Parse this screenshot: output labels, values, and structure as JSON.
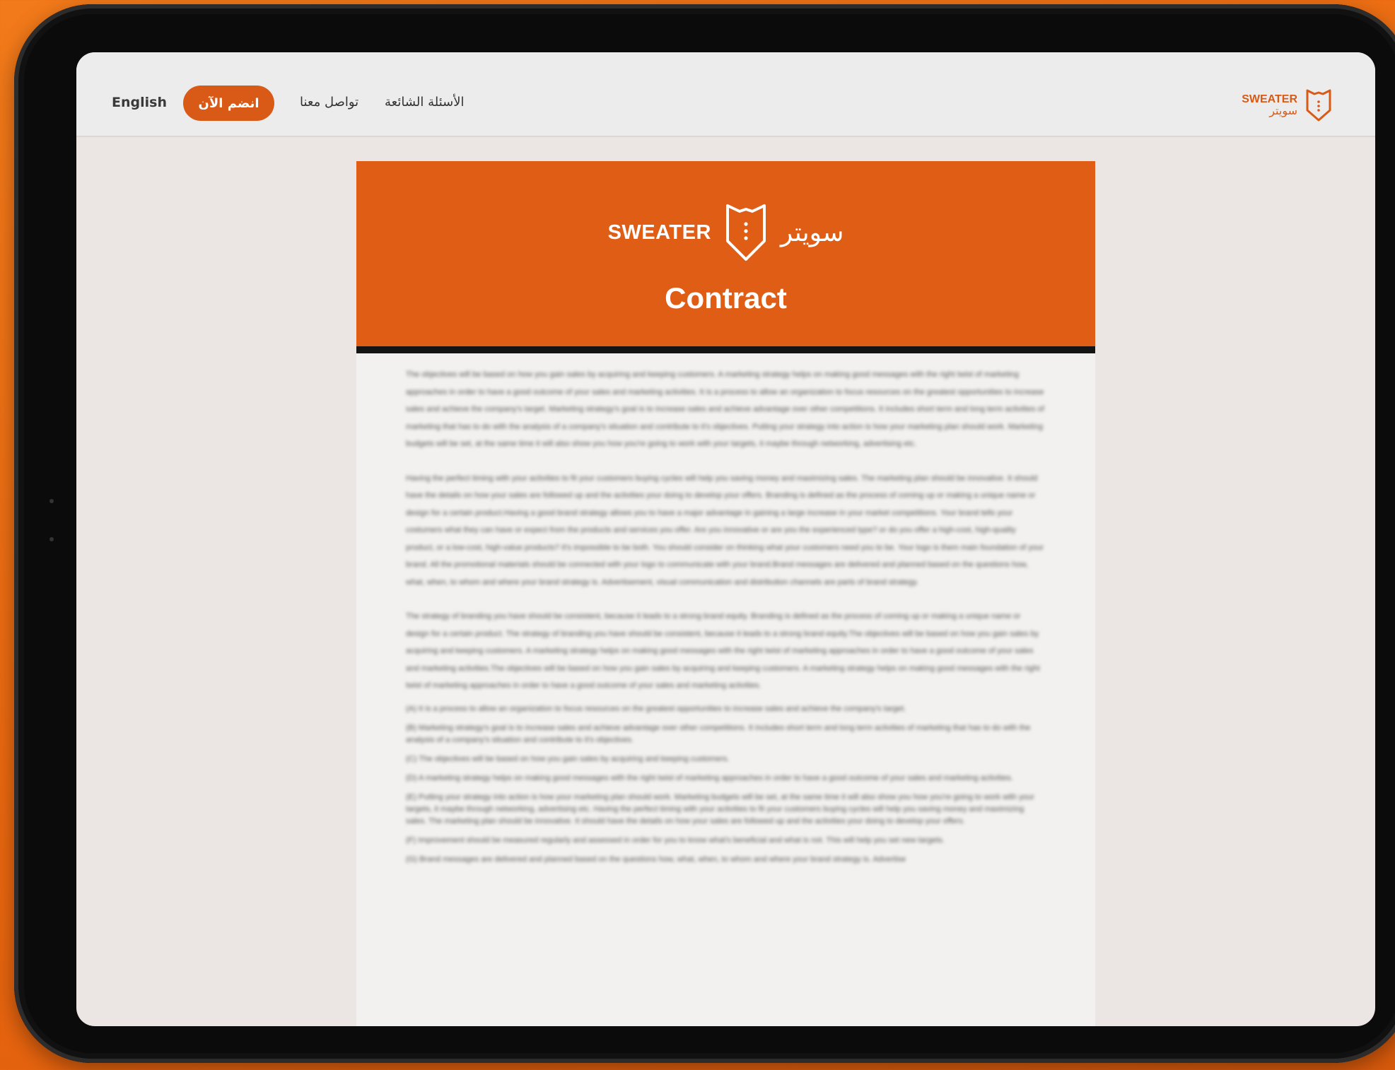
{
  "nav": {
    "language": "English",
    "join_button": "انضم الآن",
    "contact_link": "تواصل معنا",
    "faq_link": "الأسئلة الشائعة"
  },
  "brand": {
    "name_en": "SWEATER",
    "name_ar": "سويتر",
    "color": "#d95a16"
  },
  "document": {
    "title": "Contract",
    "paragraphs": [
      "The objectives will be based on how you gain sales by acquiring and keeping customers. A marketing strategy helps on making good messages with the right twist of marketing approaches in order to have a good outcome of your sales and marketing activities. It is a process to allow an organization to focus resources on the greatest opportunities to increase sales and achieve the company's target. Marketing strategy's goal is to increase sales and achieve advantage over other competitions. It includes short term and long term activities of marketing that has to do with the analysis of a company's situation and contribute to it's objectives. Putting your strategy into action is how your marketing plan should work. Marketing budgets will be set, at the same time it will also show you how you're going to work with your targets, it maybe through networking, advertising etc.",
      "Having the perfect timing with your activities to fit your customers buying cycles will help you saving money and maximizing sales. The marketing plan should be innovative. It should have the details on how your sales are followed up and the activities your doing to develop your offers. Branding is defined as the process of coming up or making a unique name or design for a certain product.Having a good brand strategy allows you to have a major advantage in gaining a large increase in your market competitions. Your brand tells your costumers what they can have or expect from the products and services you offer. Are you innovative or are you the experienced type? or do you offer a high-cost, high-quality product, or a low-cost, high-value products? It's impossible to be both. You should consider on thinking what your customers need you to be. Your logo is them main foundation of your brand. All the promotional materials should be connected with your logo to communicate with your brand.Brand messages are delivered and planned based on the questions how, what, when, to whom and where your brand strategy is. Advertisement, visual communication and distribution channels are parts of brand strategy.",
      "The strategy of branding you have should be consistent, because it leads to a strong brand equity. Branding is defined as the process of coming up or making a unique name or design for a certain product. The strategy of branding you have should be consistent, because it leads to a strong brand equity.The objectives will be based on how you gain sales by acquiring and keeping customers. A marketing strategy helps on making good messages with the right twist of marketing approaches in order to have a good outcome of your sales and marketing activities.The objectives will be based on how you gain sales by acquiring and keeping customers. A marketing strategy helps on making good messages with the right twist of marketing approaches in order to have a good outcome of your sales and marketing activities."
    ],
    "items": [
      "(A) It is a process to allow an organization to focus resources on the greatest opportunities to increase sales and achieve the company's target.",
      "(B) Marketing strategy's goal is to increase sales and achieve advantage over other competitions. It includes short term and long term activities of marketing that has to do with the analysis of a company's situation and contribute to it's objectives.",
      "(C) The objectives will be based on how you gain sales by acquiring and keeping customers.",
      "(D) A marketing strategy helps on making good messages with the right twist of marketing approaches in order to have a good outcome of your sales and marketing activities.",
      "(E) Putting your strategy into action is how your marketing plan should work. Marketing budgets will be set, at the same time it will also show you how you're going to work with your targets, it maybe through networking, advertising etc. Having the perfect timing with your activities to fit your customers buying cycles will help you saving money and maximizing sales. The marketing plan should be innovative. It should have the details on how your sales are followed up and the activities your doing to develop your offers.",
      "(F) Improvement should be measured regularly and assessed in order for you to know what's beneficial and what is not. This will help you set new targets.",
      "(G) Brand messages are delivered and planned based on the questions how, what, when, to whom and where your brand strategy is. Advertise"
    ]
  },
  "colors": {
    "accent": "#e05d16",
    "background": "#ef6f14"
  }
}
